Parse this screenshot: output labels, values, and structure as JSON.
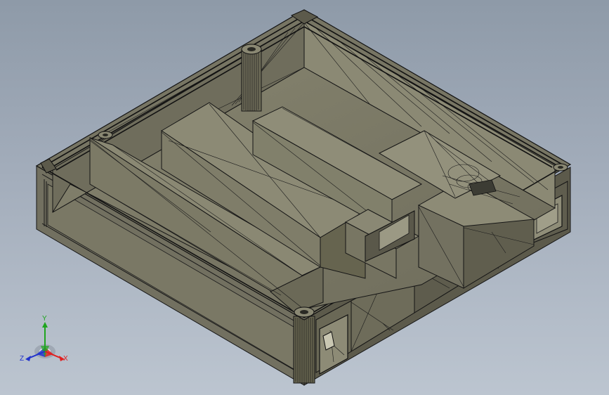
{
  "app": {
    "view": "isometric",
    "display_mode": "shaded-with-edges"
  },
  "model": {
    "kind": "open rectangular tray with internal compartments",
    "shade_color": "#7d7b68",
    "edge_color": "#141414"
  },
  "triad": {
    "x_label": "X",
    "y_label": "Y",
    "z_label": "Z",
    "x_color": "#e02020",
    "y_color": "#1fa51f",
    "z_color": "#2233cc"
  },
  "colors": {
    "background_top": "#8e9aa8",
    "background_bottom": "#bcc5d0"
  }
}
